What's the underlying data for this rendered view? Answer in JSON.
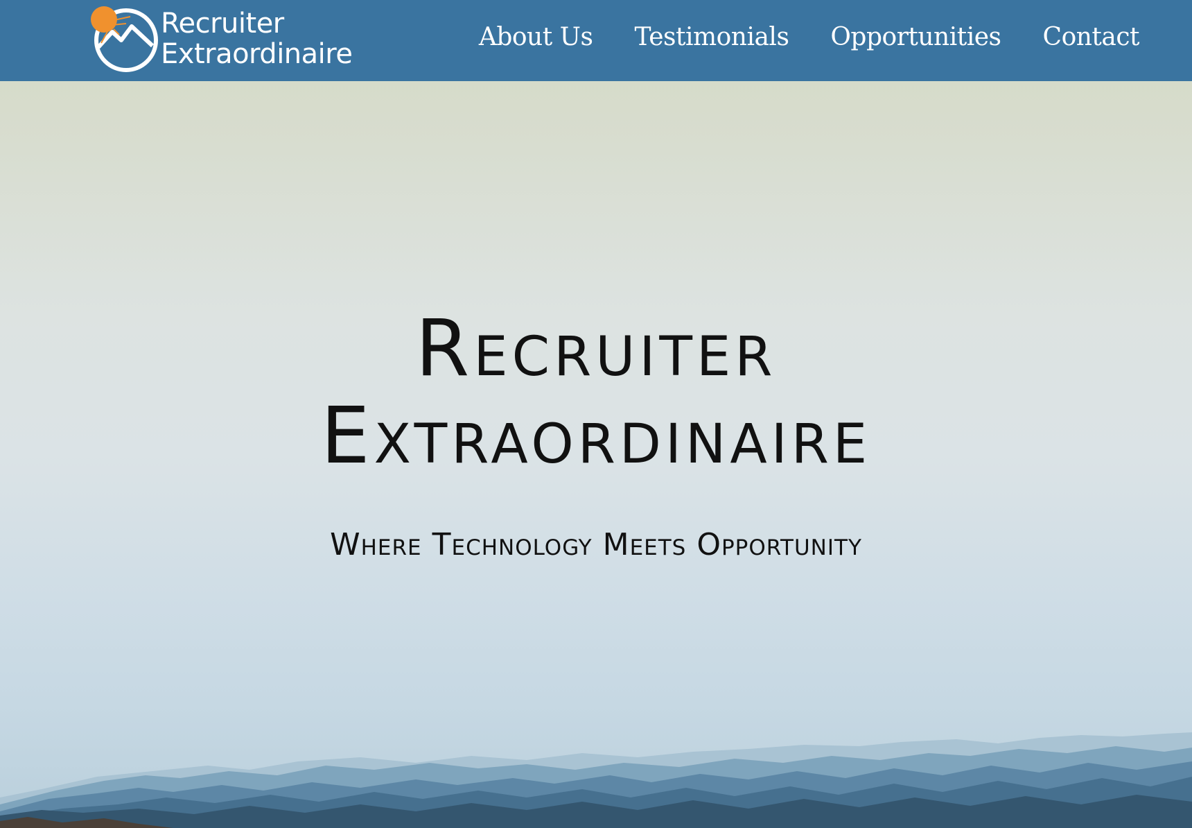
{
  "brand": {
    "line1": "Recruiter",
    "line2": "Extraordinaire",
    "sun_color": "#f0912e",
    "nav_color": "#3a74a0"
  },
  "nav": {
    "items": [
      {
        "label": "About Us"
      },
      {
        "label": "Testimonials"
      },
      {
        "label": "Opportunities"
      },
      {
        "label": "Contact"
      }
    ]
  },
  "hero": {
    "title_line1": "Recruiter",
    "title_line2": "Extraordinaire",
    "subtitle": "Where Technology Meets Opportunity"
  }
}
